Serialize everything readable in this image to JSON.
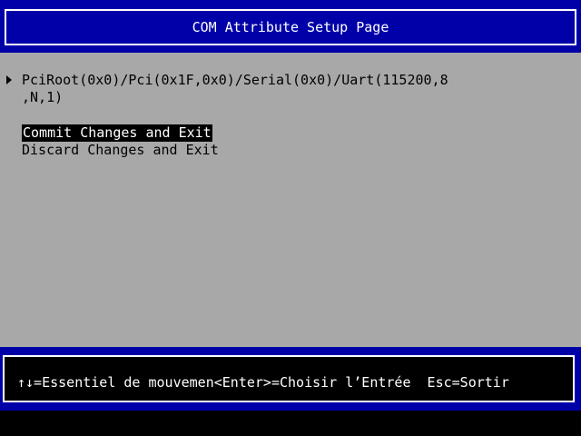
{
  "header": {
    "title": "COM Attribute Setup Page"
  },
  "menu": {
    "device_path_line1": "PciRoot(0x0)/Pci(0x1F,0x0)/Serial(0x0)/Uart(115200,8",
    "device_path_line2": ",N,1)",
    "pointer_icon": "right-triangle-icon",
    "commit_label": "Commit Changes and Exit",
    "discard_label": "Discard Changes and Exit"
  },
  "footer": {
    "help_text": "↑↓=Essentiel de mouvemen<Enter>=Choisir l’Entrée  Esc=Sortir"
  },
  "colors": {
    "header_bg": "#0000a8",
    "body_bg": "#a8a8a8",
    "highlight_bg": "#000000",
    "highlight_fg": "#ffffff",
    "text": "#000000"
  }
}
